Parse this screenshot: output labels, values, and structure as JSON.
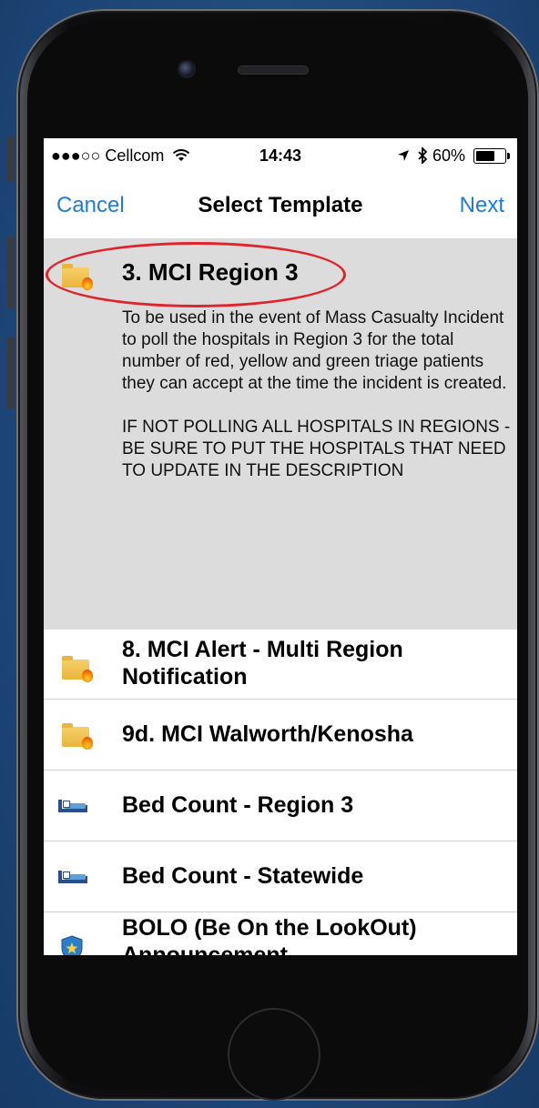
{
  "status_bar": {
    "carrier": "●●●○○ Cellcom",
    "wifi": "∷",
    "time": "14:43",
    "location_arrow": "↗",
    "bluetooth": "✱",
    "battery_percent": "60%",
    "battery_level": 0.6
  },
  "nav": {
    "cancel_label": "Cancel",
    "title": "Select Template",
    "next_label": "Next"
  },
  "selected": {
    "title": "3. MCI Region 3",
    "description_1": "To be used in the event of Mass Casualty Incident to poll the hospitals in Region 3 for the total number of red, yellow and green triage patients they can accept at the time the incident is created.",
    "description_2": "IF NOT POLLING ALL HOSPITALS IN REGIONS - BE SURE TO PUT THE HOSPITALS THAT NEED TO UPDATE IN THE DESCRIPTION",
    "annotation_color": "#e0242c"
  },
  "templates": [
    {
      "label": "8. MCI Alert - Multi Region Notification",
      "icon": "folder-fire-icon"
    },
    {
      "label": "9d. MCI Walworth/Kenosha",
      "icon": "folder-fire-icon"
    },
    {
      "label": "Bed Count - Region 3",
      "icon": "bed-icon"
    },
    {
      "label": "Bed Count - Statewide",
      "icon": "bed-icon"
    },
    {
      "label": "BOLO (Be On the LookOut) Announcement",
      "icon": "police-badge-icon"
    }
  ],
  "colors": {
    "accent": "#1f7bd8",
    "background": "#1f4a7c",
    "selected_row": "#dcdcdc"
  }
}
